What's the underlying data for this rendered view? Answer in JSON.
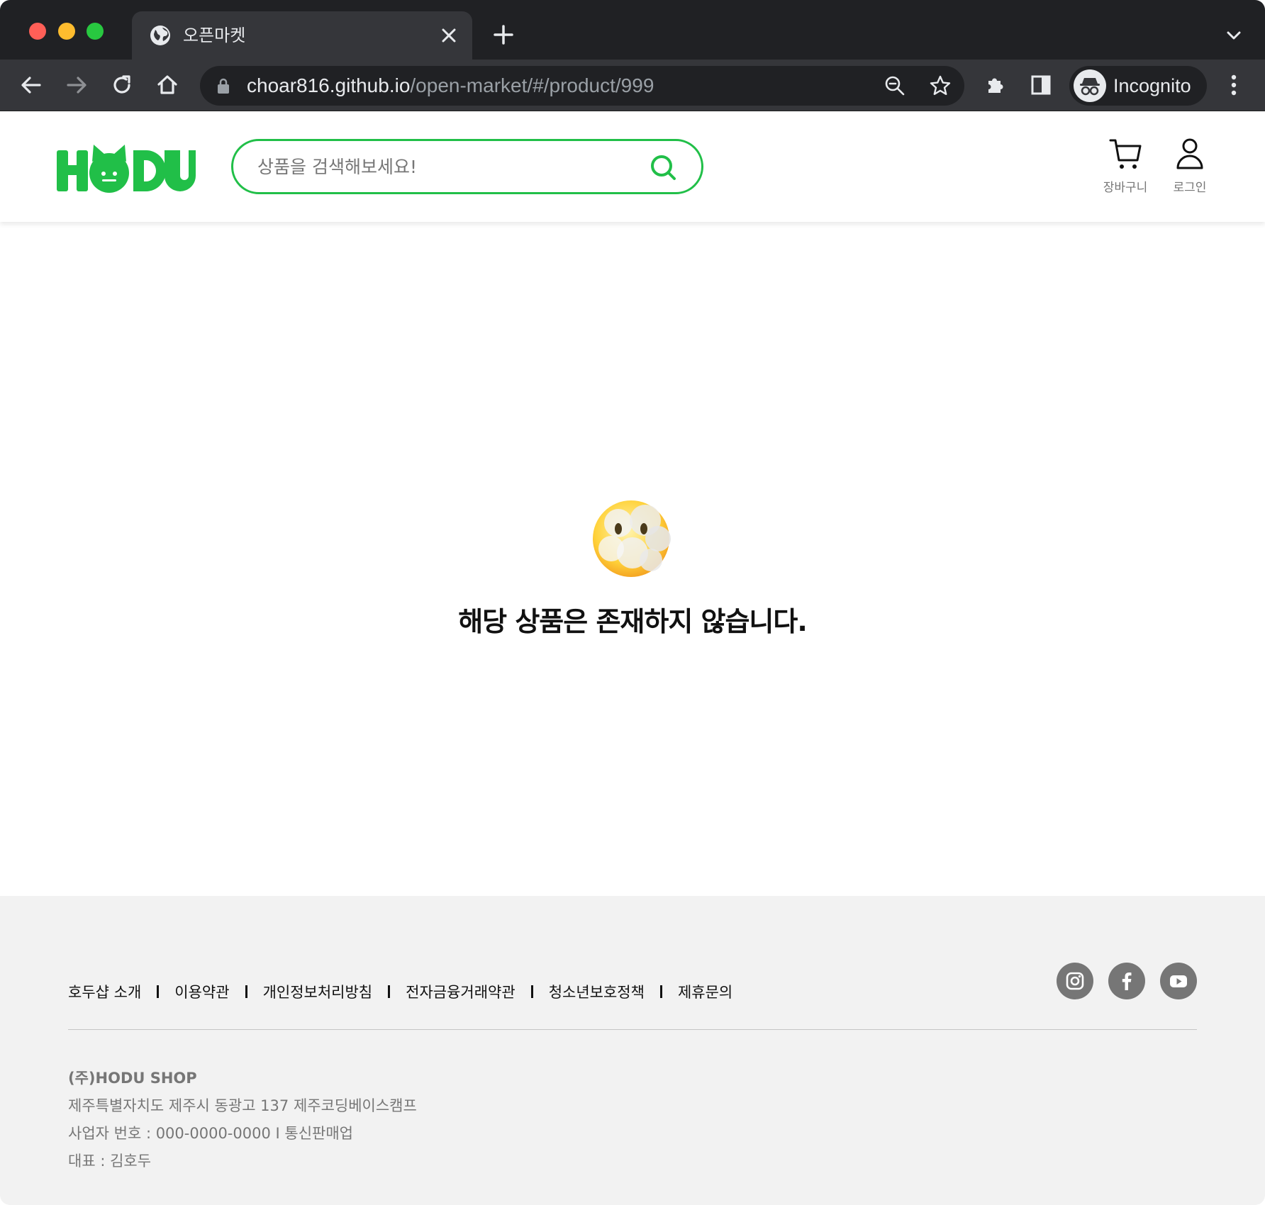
{
  "browser": {
    "tab_title": "오픈마켓",
    "url_host": "choar816.github.io",
    "url_path": "/open-market/#/product/999",
    "incognito_label": "Incognito"
  },
  "header": {
    "logo_text": "HODU",
    "search_placeholder": "상품을 검색해보세요!",
    "cart_label": "장바구니",
    "login_label": "로그인"
  },
  "main": {
    "message": "해당 상품은 존재하지 않습니다."
  },
  "footer": {
    "links": [
      "호두샵 소개",
      "이용약관",
      "개인정보처리방침",
      "전자금융거래약관",
      "청소년보호정책",
      "제휴문의"
    ],
    "company_name": "(주)HODU SHOP",
    "address": "제주특별자치도 제주시 동광고 137 제주코딩베이스캠프",
    "business": "사업자 번호 : 000-0000-0000 I 통신판매업",
    "ceo": "대표 : 김호두",
    "social": [
      "instagram-icon",
      "facebook-icon",
      "youtube-icon"
    ]
  },
  "colors": {
    "brand": "#21BF48",
    "footer_bg": "#F2F2F2",
    "chrome_dark": "#202124",
    "chrome_toolbar": "#35363A"
  }
}
